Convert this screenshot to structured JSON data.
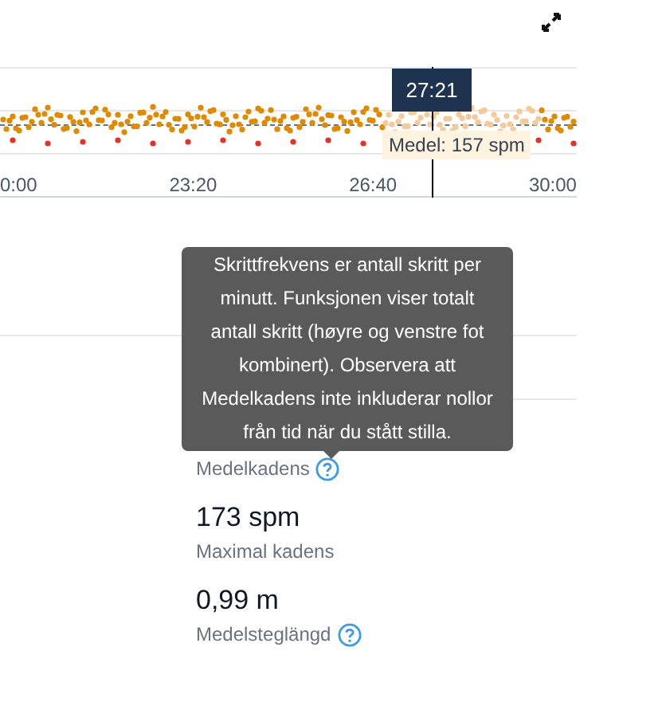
{
  "chart": {
    "cursor_time": "27:21",
    "average_label": "Medel: 157 spm",
    "x_labels": [
      "0:00",
      "23:20",
      "26:40",
      "30:00"
    ]
  },
  "tooltip": {
    "text": "Skrittfrekvens er antall skritt per minutt. Funksjonen viser totalt antall skritt (høyre og venstre fot kombinert). Observera att Medelkadens inte inkluderar nollor från tid när du stått stilla."
  },
  "stats": [
    {
      "label": "Medelkadens",
      "help": true
    },
    {
      "value": "173 spm",
      "label": "Maximal kadens",
      "help": false
    },
    {
      "value": "0,99 m",
      "label": "Medelsteglängd",
      "help": true
    }
  ]
}
